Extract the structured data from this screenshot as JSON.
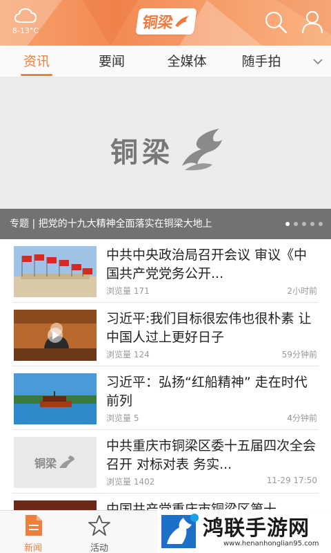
{
  "header": {
    "weather_temp": "8-13°C",
    "logo_text": "铜梁",
    "weather_icon": "cloud-icon",
    "search_icon": "search-icon",
    "user_icon": "user-icon"
  },
  "tabs": [
    {
      "label": "资讯",
      "active": true
    },
    {
      "label": "要闻",
      "active": false
    },
    {
      "label": "全媒体",
      "active": false
    },
    {
      "label": "随手拍",
      "active": false
    }
  ],
  "banner": {
    "logo_text": "铜梁",
    "caption": "专题 | 把党的十九大精神全面落实在铜梁大地上",
    "dots_total": 5,
    "dots_active": 0
  },
  "news": [
    {
      "title": "中共中央政治局召开会议 审议《中国共产党党务公开...",
      "views": "浏览量 171",
      "time": "2小时前",
      "thumb": "flags"
    },
    {
      "title": "习近平:我们目标很宏伟也很朴素 让中国人过上更好日子",
      "views": "浏览量 124",
      "time": "59分钟前",
      "thumb": "video"
    },
    {
      "title": "习近平：弘扬“红船精神” 走在时代前列",
      "views": "浏览量 5",
      "time": "4分钟前",
      "thumb": "boat"
    },
    {
      "title": "中共重庆市铜梁区委十五届四次全会召开 对标对表  务实...",
      "views": "浏览量 1402",
      "time": "11-29 17:50",
      "thumb": "logo"
    },
    {
      "title": "中国共产党重庆市铜梁区第十",
      "views": "",
      "time": "",
      "thumb": "partial"
    }
  ],
  "thumb_logo_text": "铜梁",
  "bottom_nav": [
    {
      "label": "新闻",
      "icon": "news-icon",
      "active": true
    },
    {
      "label": "活动",
      "icon": "star-icon",
      "active": false
    }
  ],
  "watermark": {
    "text": "鸿联手游网",
    "url": "www.henanhonglian95.com"
  },
  "colors": {
    "accent": "#ee7f3d",
    "header_gradient": "#f48a55"
  }
}
